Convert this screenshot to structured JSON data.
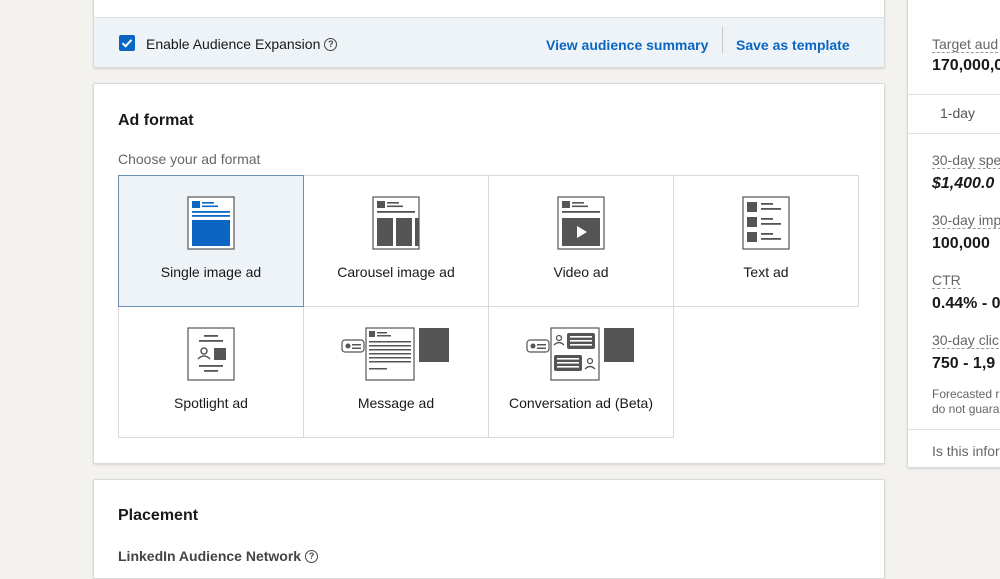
{
  "audience": {
    "expansion_checked": true,
    "expansion_label": "Enable Audience Expansion",
    "view_summary": "View audience summary",
    "save_template": "Save as template"
  },
  "ad_format": {
    "title": "Ad format",
    "subtitle": "Choose your ad format",
    "options": [
      {
        "label": "Single image ad",
        "icon": "single-image-ad-icon",
        "selected": true
      },
      {
        "label": "Carousel image ad",
        "icon": "carousel-ad-icon",
        "selected": false
      },
      {
        "label": "Video ad",
        "icon": "video-ad-icon",
        "selected": false
      },
      {
        "label": "Text ad",
        "icon": "text-ad-icon",
        "selected": false
      },
      {
        "label": "Spotlight ad",
        "icon": "spotlight-ad-icon",
        "selected": false
      },
      {
        "label": "Message ad",
        "icon": "message-ad-icon",
        "selected": false
      },
      {
        "label": "Conversation ad (Beta)",
        "icon": "conversation-ad-icon",
        "selected": false
      }
    ]
  },
  "placement": {
    "title": "Placement",
    "network_label": "LinkedIn Audience Network"
  },
  "forecast": {
    "target_audience_label": "Target aud",
    "target_audience_value": "170,000,0",
    "tab_label": "1-day",
    "spend_label": "30-day spe",
    "spend_value": "$1,400.0",
    "impressions_label": "30-day imp",
    "impressions_value": "100,000",
    "ctr_label": "CTR",
    "ctr_value": "0.44% - 0",
    "clicks_label": "30-day clic",
    "clicks_value": "750 - 1,9",
    "disclaimer_line1": "Forecasted r",
    "disclaimer_line2": "do not guara",
    "feedback": "Is this infor"
  },
  "colors": {
    "accent": "#0a66c2",
    "icon_dark": "#555555",
    "selected_bg": "#eef3f8"
  }
}
